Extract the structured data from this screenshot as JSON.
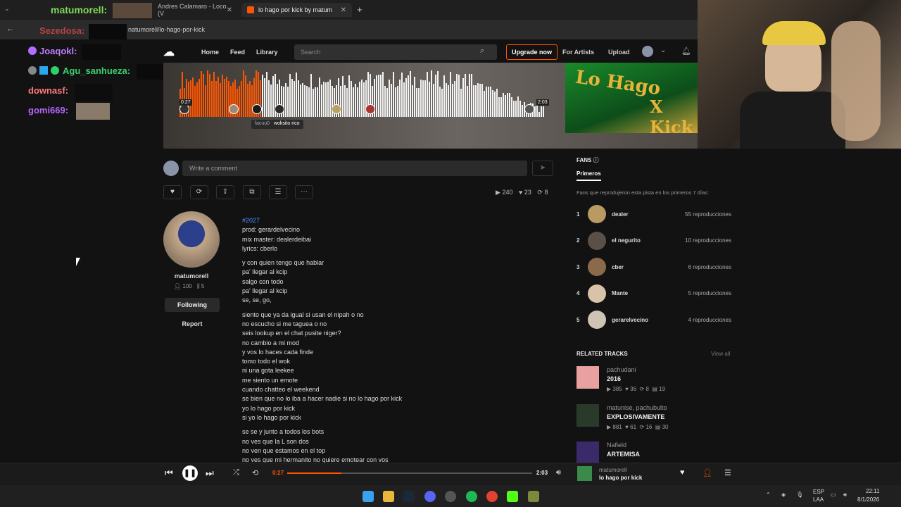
{
  "browser": {
    "tabs": [
      {
        "label": "Andres Calamaro - Loco (V"
      },
      {
        "label": "lo hago por kick by matum"
      }
    ],
    "url": "natumorell/lo-hago-por-kick"
  },
  "chat": [
    {
      "user": "matumorell:",
      "color": "#7ed957"
    },
    {
      "user": "Sezedosa:",
      "color": "#e84a4a"
    },
    {
      "user": "Joaqokl:",
      "color": "#c07dff"
    },
    {
      "user": "Agu_sanhueza:",
      "color": "#3bd16f"
    },
    {
      "user": "downasf:",
      "color": "#ff7b7b"
    },
    {
      "user": "gomi669:",
      "color": "#b565ff"
    }
  ],
  "header": {
    "nav": [
      "Home",
      "Feed",
      "Library"
    ],
    "search_placeholder": "Search",
    "upgrade": "Upgrade now",
    "for_artists": "For Artists",
    "upload": "Upload"
  },
  "hero": {
    "time_current": "0:27",
    "time_total": "2:03",
    "comment_user": "facuu0",
    "comment_text": "woksito rico",
    "cover_text1": "Lo Hago",
    "cover_text2": "X Kick"
  },
  "comment": {
    "placeholder": "Write a comment"
  },
  "stats": {
    "plays": "240",
    "likes": "23",
    "reposts": "8"
  },
  "artist": {
    "name": "matumorell",
    "followers": "100",
    "tracks": "5",
    "following_label": "Following",
    "report_label": "Report"
  },
  "description": {
    "tag": "#2027",
    "block1": [
      "prod: gerardelvecino",
      "mix master: dealerdeibai",
      "lyrics: cberlo"
    ],
    "block2": [
      "y con quien tengo que hablar",
      "pa' llegar al kcip",
      "salgo con todo",
      "pa' llegar al kcip",
      "se, se, go,"
    ],
    "block3": [
      "siento que ya da igual si usan el nipah o no",
      "no escucho si me taguea o no",
      "seis lookup en el chat pusite niger?",
      "no cambio a mi mod",
      "y vos lo haces cada finde",
      "tomo todo el wok",
      "ni una gota leekee",
      "me siento un emote",
      "cuando chatteo el weekend",
      "se bien que no lo iba a hacer nadie si no lo hago por kick",
      "yo lo hago por kick",
      "si yo lo hago por kick"
    ],
    "block4": [
      "se se y junto a todos los bots",
      "no ves que la L son dos",
      "no ven que estamos en el top",
      "no ves que mi hermanito no quiere emotear con vos"
    ]
  },
  "fans": {
    "title": "FANS",
    "tab": "Primeros",
    "subtitle": "Fans que reprodujeron esta pista en los primeros 7 días:",
    "list": [
      {
        "rank": "1",
        "name": "dealer",
        "count": "55 reproducciones"
      },
      {
        "rank": "2",
        "name": "el negurito",
        "count": "10 reproducciones"
      },
      {
        "rank": "3",
        "name": "cber",
        "count": "6 reproducciones"
      },
      {
        "rank": "4",
        "name": "Mante",
        "count": "5 reproducciones"
      },
      {
        "rank": "5",
        "name": "gerarelvecino",
        "count": "4 reproducciones"
      }
    ]
  },
  "related": {
    "title": "RELATED TRACKS",
    "view_all": "View all",
    "tracks": [
      {
        "user": "pachudani",
        "title": "2016",
        "plays": "385",
        "likes": "36",
        "reposts": "8",
        "comments": "19"
      },
      {
        "user": "matunise, pachubulto",
        "title": "EXPLOSIVAMENTE",
        "plays": "881",
        "likes": "61",
        "reposts": "16",
        "comments": "30"
      },
      {
        "user": "Nafield",
        "title": "ARTEMISA"
      }
    ]
  },
  "player": {
    "current": "0:27",
    "total": "2:03",
    "progress": 0.22,
    "artist": "matumorell",
    "title": "lo hago por kick"
  },
  "taskbar": {
    "lang": "ESP",
    "lang2": "LAA",
    "time": "22:11",
    "date": "8/1/2026"
  }
}
